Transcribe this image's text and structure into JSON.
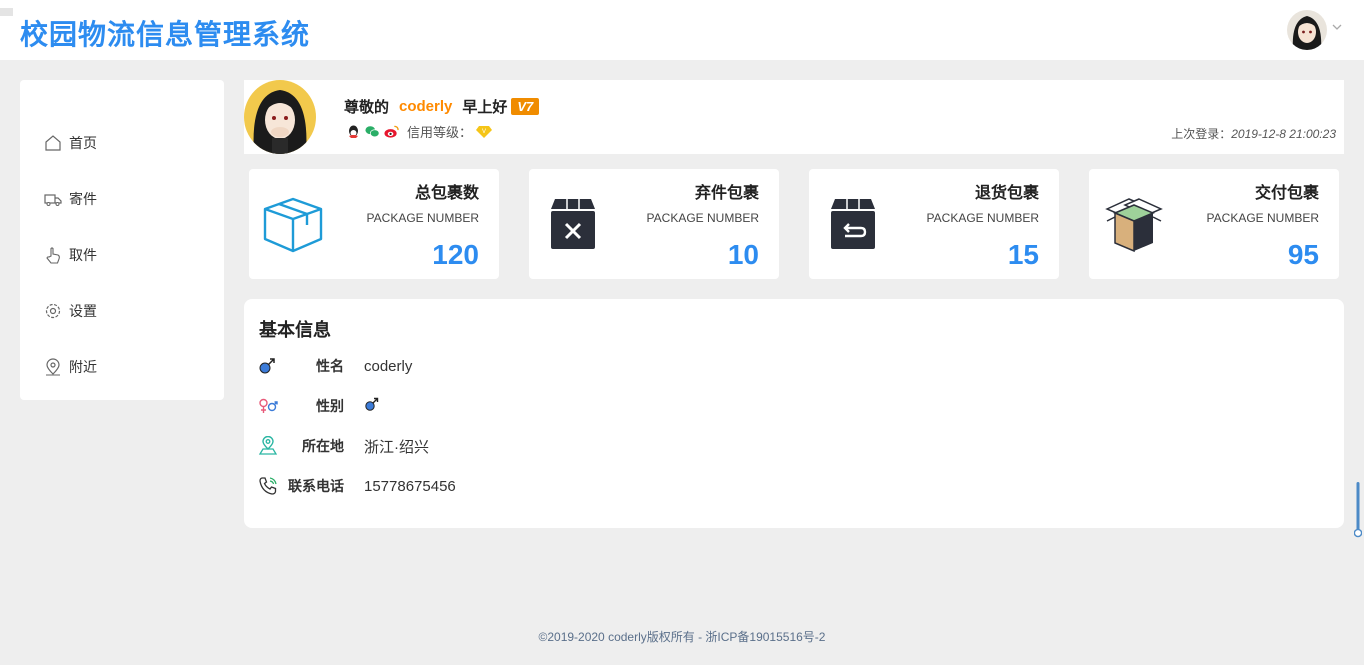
{
  "app": {
    "title": "校园物流信息管理系统"
  },
  "sidebar": {
    "items": [
      {
        "label": "首页",
        "icon": "home-icon"
      },
      {
        "label": "寄件",
        "icon": "truck-icon"
      },
      {
        "label": "取件",
        "icon": "hand-icon"
      },
      {
        "label": "设置",
        "icon": "gear-icon"
      },
      {
        "label": "附近",
        "icon": "location-icon"
      }
    ]
  },
  "profile": {
    "greeting_prefix": "尊敬的",
    "username": "coderly",
    "greeting_suffix": "早上好",
    "vip_badge": "V7",
    "credit_label": "信用等级：",
    "last_login_label": "上次登录：",
    "last_login_time": "2019-12-8 21:00:23"
  },
  "cards": [
    {
      "title": "总包裹数",
      "subtitle": "PACKAGE NUMBER",
      "value": "120",
      "icon": "package-icon"
    },
    {
      "title": "弃件包裹",
      "subtitle": "PACKAGE NUMBER",
      "value": "10",
      "icon": "box-x-icon"
    },
    {
      "title": "退货包裹",
      "subtitle": "PACKAGE NUMBER",
      "value": "15",
      "icon": "box-return-icon"
    },
    {
      "title": "交付包裹",
      "subtitle": "PACKAGE NUMBER",
      "value": "95",
      "icon": "open-box-icon"
    }
  ],
  "info": {
    "title": "基本信息",
    "rows": [
      {
        "label": "性名",
        "value": "coderly",
        "icon": "male-icon"
      },
      {
        "label": "性别",
        "value": "♂",
        "icon": "gender-icon"
      },
      {
        "label": "所在地",
        "value": "浙江·绍兴",
        "icon": "map-pin-icon"
      },
      {
        "label": "联系电话",
        "value": "15778675456",
        "icon": "phone-icon"
      }
    ]
  },
  "footer": {
    "text": "©2019-2020 coderly版权所有 - 浙ICP备19015516号-2"
  },
  "colors": {
    "accent": "#2d8cf0",
    "username": "#ff8a00",
    "vip": "#f08c00"
  }
}
